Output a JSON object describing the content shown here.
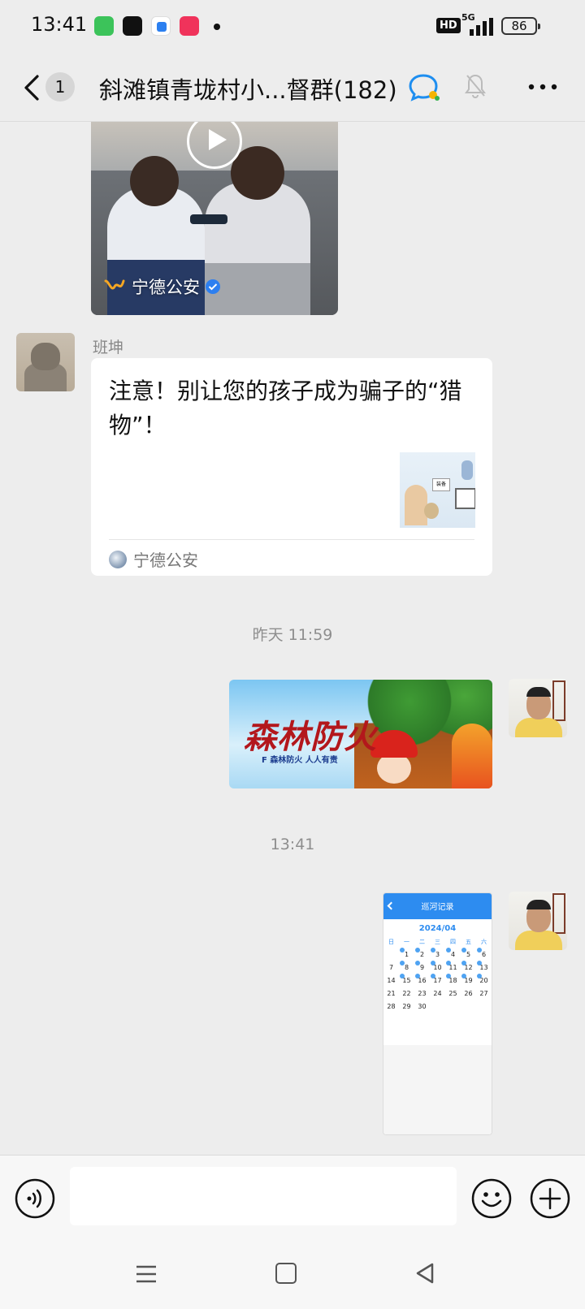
{
  "status_bar": {
    "time": "13:41",
    "hd_label": "HD",
    "network_label": "5G",
    "battery": "86",
    "app_icons": [
      "messages-app-icon",
      "tiktok-app-icon",
      "blue-app-icon",
      "video-app-icon"
    ]
  },
  "header": {
    "unread_count": "1",
    "title": "斜滩镇青垅村小...督群(182)"
  },
  "messages": {
    "video_share": {
      "source": "宁德公安"
    },
    "link_share": {
      "sender": "班坤",
      "title": "注意！别让您的孩子成为骗子的“猎物”！",
      "thumb_text_1": "装备",
      "source": "宁德公安"
    },
    "timestamp_1": "昨天 11:59",
    "image_banner": {
      "title": "森林防火",
      "subtitle": "F 森林防火 人人有责"
    },
    "timestamp_2": "13:41",
    "image_screenshot": {
      "header": "巡河记录",
      "month": "2024/04",
      "weekdays": [
        "日",
        "一",
        "二",
        "三",
        "四",
        "五",
        "六"
      ],
      "days": [
        "",
        "1",
        "2",
        "3",
        "4",
        "5",
        "6",
        "7",
        "8",
        "9",
        "10",
        "11",
        "12",
        "13",
        "14",
        "15",
        "16",
        "17",
        "18",
        "19",
        "20",
        "21",
        "22",
        "23",
        "24",
        "25",
        "26",
        "27",
        "28",
        "29",
        "30"
      ]
    }
  },
  "colors": {
    "background": "#ededed",
    "accent_blue": "#2d8cf0",
    "banner_red": "#b3171c"
  }
}
